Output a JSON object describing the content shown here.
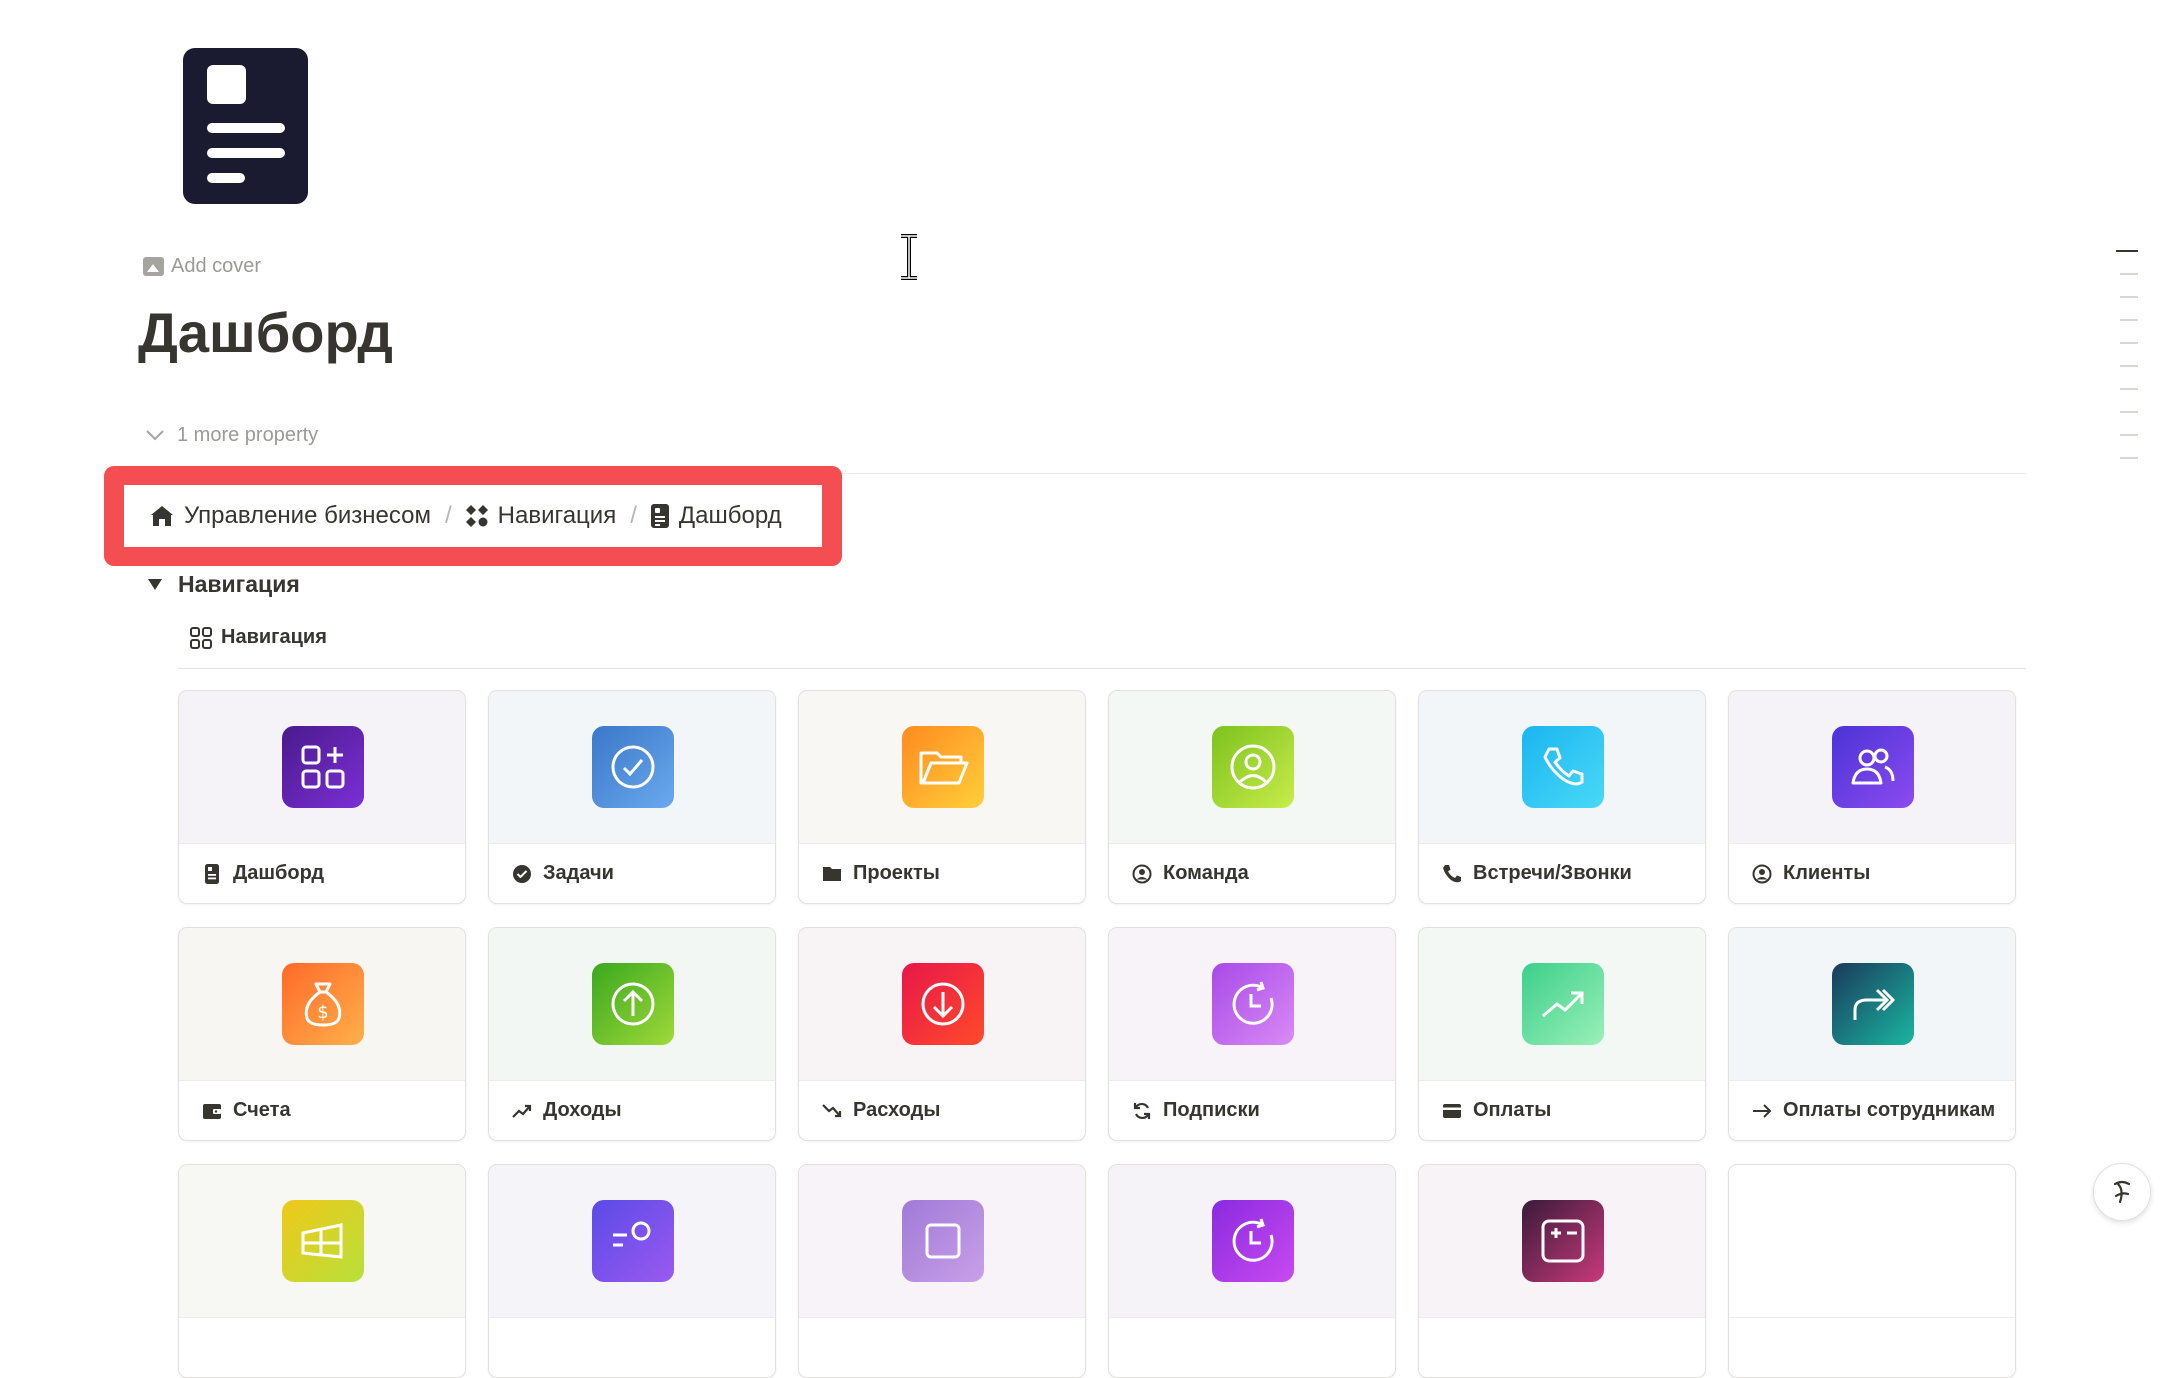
{
  "page": {
    "add_cover": "Add cover",
    "title": "Дашборд",
    "more_property": "1 more property"
  },
  "breadcrumb": [
    {
      "label": "Управление бизнесом",
      "icon": "home-icon"
    },
    {
      "label": "Навигация",
      "icon": "grid-icon"
    },
    {
      "label": "Дашборд",
      "icon": "document-icon"
    }
  ],
  "breadcrumb_separator": "/",
  "toggle": {
    "label": "Навигация"
  },
  "view": {
    "tab_label": "Навигация",
    "icon": "gallery-icon"
  },
  "cards": [
    {
      "label": "Дашборд",
      "icon": "document-icon",
      "tile_icon": "dashboard-icon",
      "grad": [
        "#4a1a8c",
        "#7b2fd6"
      ],
      "bg": "#f6f3f8"
    },
    {
      "label": "Задачи",
      "icon": "check-circle-icon",
      "tile_icon": "check-icon",
      "grad": [
        "#3a78c9",
        "#6aa8ee"
      ],
      "bg": "#f3f6f8"
    },
    {
      "label": "Проекты",
      "icon": "folder-icon",
      "tile_icon": "folder-open-icon",
      "grad": [
        "#ff8a1f",
        "#ffcf3a"
      ],
      "bg": "#f8f7f3"
    },
    {
      "label": "Команда",
      "icon": "user-circle-icon",
      "tile_icon": "user-icon",
      "grad": [
        "#7dc21e",
        "#c8ec4a"
      ],
      "bg": "#f3f8f4"
    },
    {
      "label": "Встречи/Звонки",
      "icon": "phone-icon",
      "tile_icon": "phone-icon",
      "grad": [
        "#1ab6f0",
        "#4ad8f7"
      ],
      "bg": "#f3f6f8"
    },
    {
      "label": "Клиенты",
      "icon": "user-circle-icon",
      "tile_icon": "users-icon",
      "grad": [
        "#4b33d6",
        "#8b4bf0"
      ],
      "bg": "#f5f3f8"
    },
    {
      "label": "Счета",
      "icon": "wallet-icon",
      "tile_icon": "money-bag-icon",
      "grad": [
        "#ff6a2a",
        "#ffb04a"
      ],
      "bg": "#f8f6f3"
    },
    {
      "label": "Доходы",
      "icon": "trend-up-icon",
      "tile_icon": "arrow-up-circle-icon",
      "grad": [
        "#3aa81e",
        "#9fd93a"
      ],
      "bg": "#f3f7f4"
    },
    {
      "label": "Расходы",
      "icon": "trend-down-icon",
      "tile_icon": "arrow-down-circle-icon",
      "grad": [
        "#e8174a",
        "#ff4a2a"
      ],
      "bg": "#f8f3f4"
    },
    {
      "label": "Подписки",
      "icon": "refresh-icon",
      "tile_icon": "clock-icon",
      "grad": [
        "#a84ae8",
        "#d98af5"
      ],
      "bg": "#f7f3f8"
    },
    {
      "label": "Оплаты",
      "icon": "card-icon",
      "tile_icon": "trend-up-icon",
      "grad": [
        "#3ccf8a",
        "#9af0b8"
      ],
      "bg": "#f3f8f5"
    },
    {
      "label": "Оплаты сотрудникам",
      "icon": "arrow-right-icon",
      "tile_icon": "forward-icon",
      "grad": [
        "#1a3a5c",
        "#1ab6a0"
      ],
      "bg": "#f3f6f8"
    },
    {
      "label": "",
      "icon": "",
      "tile_icon": "window-icon",
      "grad": [
        "#f0c81a",
        "#b8e03a"
      ],
      "bg": "#f7f8f3"
    },
    {
      "label": "",
      "icon": "",
      "tile_icon": "user-search-icon",
      "grad": [
        "#5b4ae8",
        "#9a5af0"
      ],
      "bg": "#f5f4f8"
    },
    {
      "label": "",
      "icon": "",
      "tile_icon": "box-icon",
      "grad": [
        "#a07ad8",
        "#c8a0e8"
      ],
      "bg": "#f7f3f8"
    },
    {
      "label": "",
      "icon": "",
      "tile_icon": "clock-icon",
      "grad": [
        "#8a2ae0",
        "#c84af0"
      ],
      "bg": "#f6f3f8"
    },
    {
      "label": "",
      "icon": "",
      "tile_icon": "calculator-icon",
      "grad": [
        "#3a1a3a",
        "#c83a7a"
      ],
      "bg": "#f7f3f6"
    },
    {
      "label": "",
      "icon": "",
      "tile_icon": "",
      "grad": [
        "#ffffff",
        "#ffffff"
      ],
      "bg": "#ffffff"
    }
  ]
}
